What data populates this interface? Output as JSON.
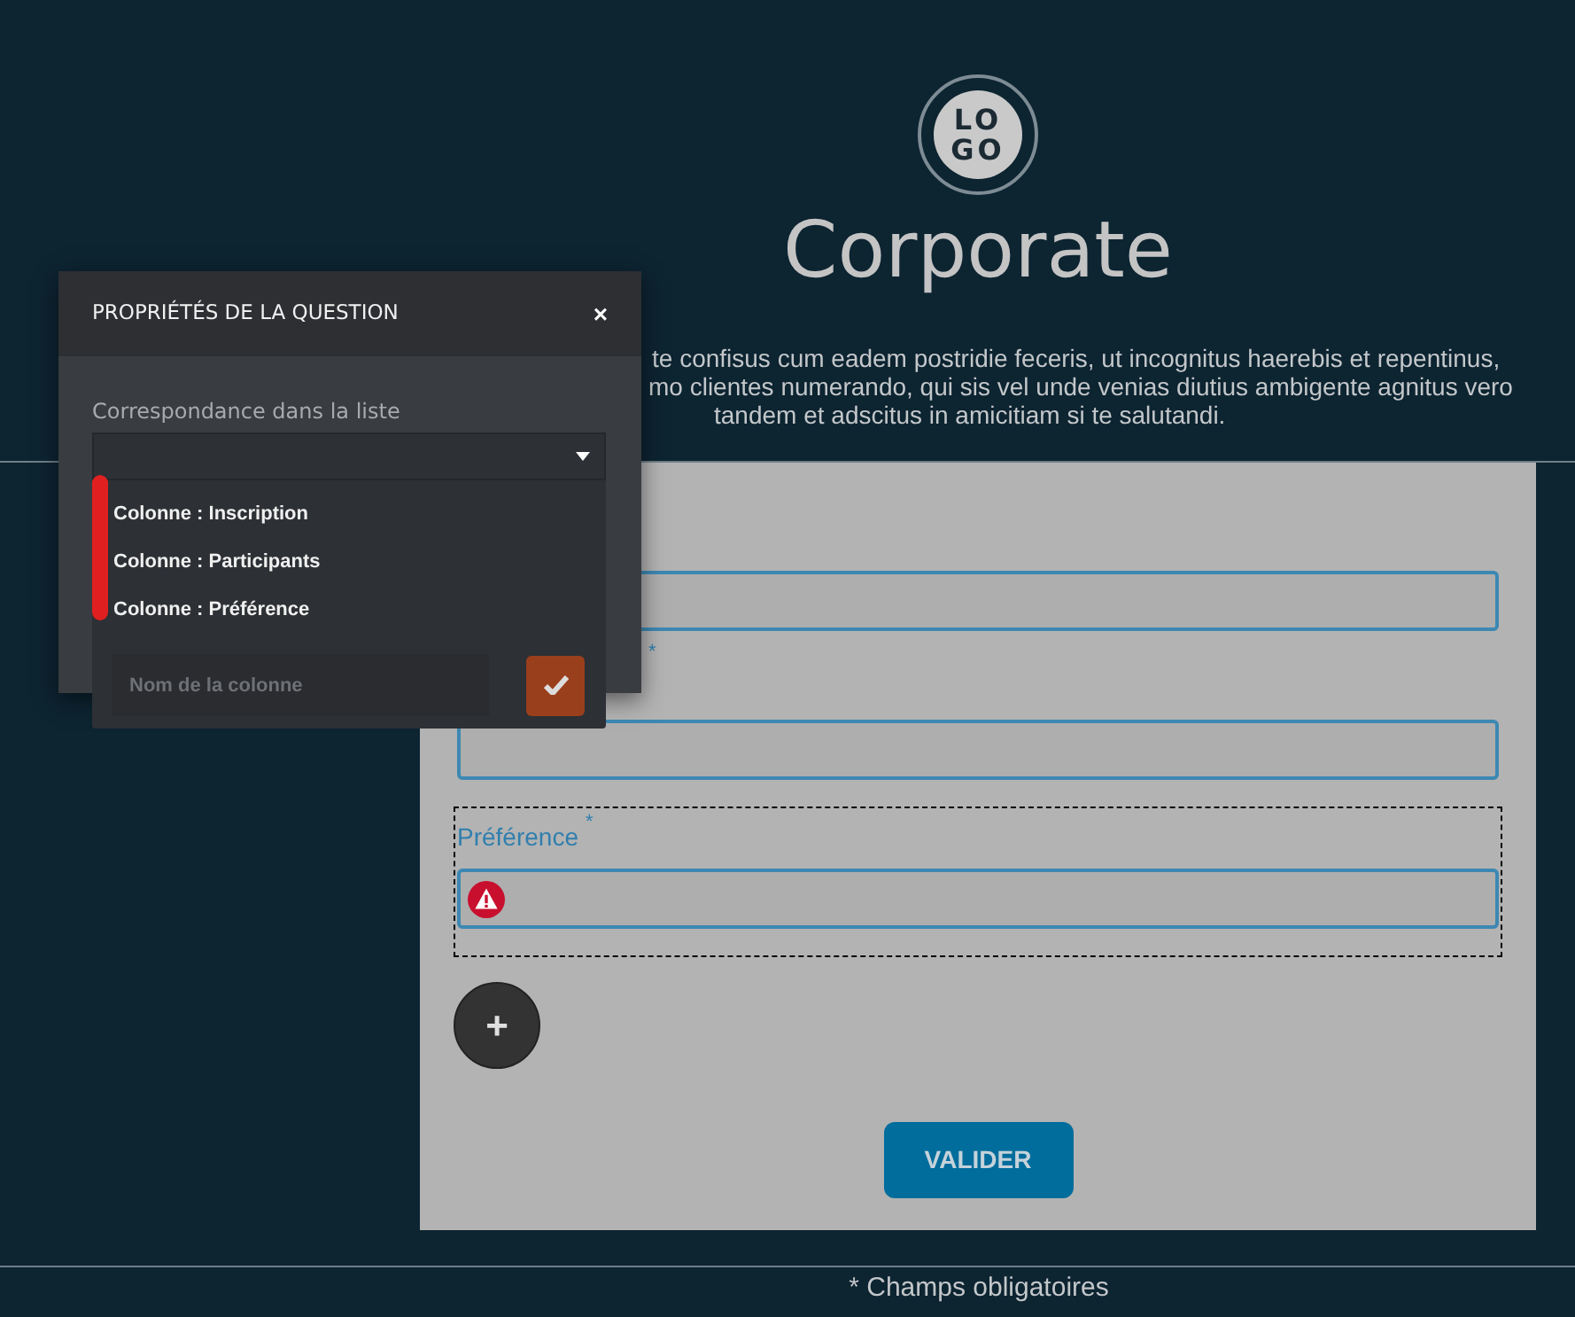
{
  "header": {
    "logo_lines": [
      "LO",
      "GO"
    ],
    "title": "Corporate",
    "intro_lines": [
      "te confisus cum eadem postridie feceris, ut incognitus haerebis et repentinus,",
      "mo clientes numerando, qui sis vel unde venias diutius ambigente agnitus vero",
      "tandem et adscitus in amicitiam si te salutandi."
    ]
  },
  "form": {
    "fields": [
      {
        "selected": false
      },
      {
        "required_mark": "*",
        "selected": false
      },
      {
        "label": "Préférence",
        "required_mark": "*",
        "error": true,
        "selected": true
      }
    ],
    "add_button": "+",
    "submit": "VALIDER"
  },
  "footer": "* Champs obligatoires",
  "dialog": {
    "title": "PROPRIÉTÉS DE LA QUESTION",
    "close": "×",
    "field_label": "Correspondance dans la liste",
    "options": [
      {
        "label": "Colonne : Inscription"
      },
      {
        "label": "Colonne : Participants"
      },
      {
        "label": "Colonne : Préférence"
      }
    ],
    "new_column": {
      "placeholder": "Nom de la colonne"
    }
  }
}
